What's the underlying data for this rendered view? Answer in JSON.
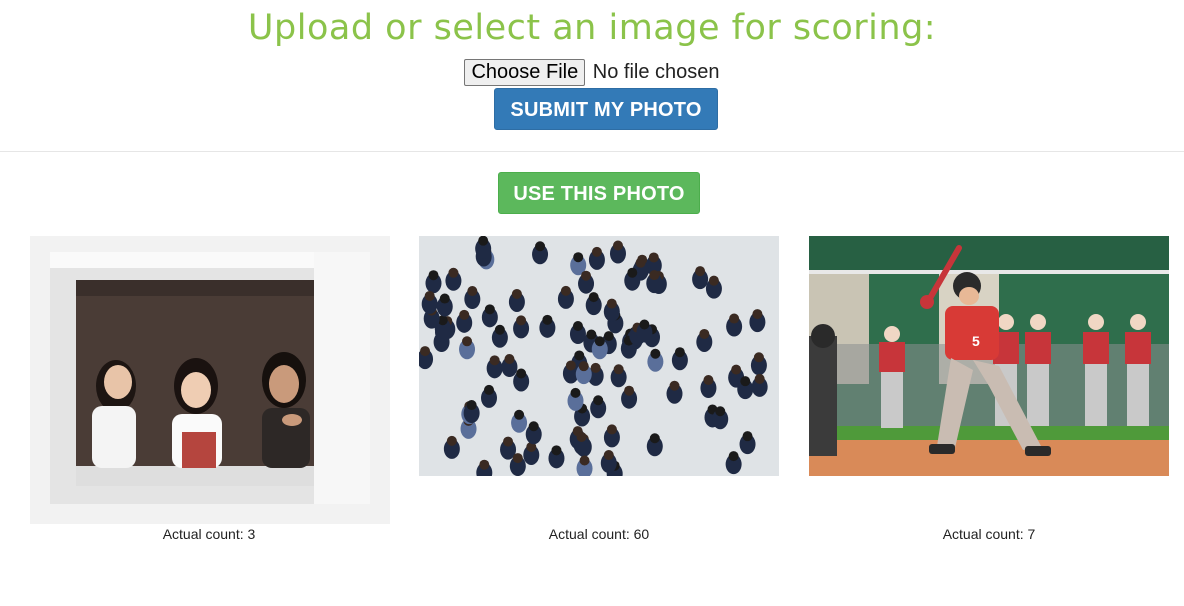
{
  "header": {
    "title": "Upload or select an image for scoring:",
    "file_button_label": "Choose File",
    "file_status": "No file chosen",
    "submit_label": "SUBMIT MY PHOTO"
  },
  "gallery": {
    "use_label": "USE THIS PHOTO",
    "items": [
      {
        "caption": "Actual count: 3"
      },
      {
        "caption": "Actual count: 60"
      },
      {
        "caption": "Actual count: 7"
      }
    ]
  },
  "colors": {
    "title": "#8bc34a",
    "submit": "#337ab7",
    "use": "#5cb85c"
  }
}
